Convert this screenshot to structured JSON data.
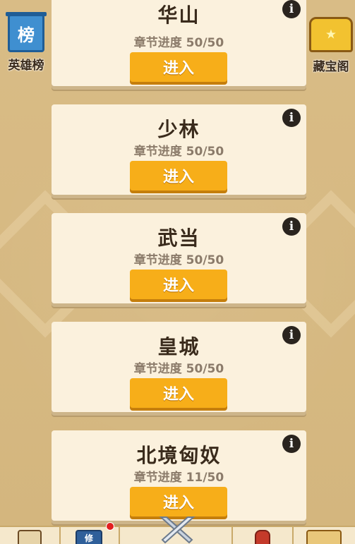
{
  "colors": {
    "background": "#d8bb84",
    "card": "#fbf1dd",
    "button": "#f7ae19",
    "title_text": "#3a2b1c",
    "progress_text": "#8b7b6a"
  },
  "side_left": {
    "icon_text": "榜",
    "label": "英雄榜"
  },
  "side_right": {
    "label": "藏宝阁"
  },
  "chapters": [
    {
      "title": "华山",
      "progress": "章节进度 50/50",
      "button": "进入",
      "info": "i"
    },
    {
      "title": "少林",
      "progress": "章节进度 50/50",
      "button": "进入",
      "info": "i"
    },
    {
      "title": "武当",
      "progress": "章节进度 50/50",
      "button": "进入",
      "info": "i"
    },
    {
      "title": "皇城",
      "progress": "章节进度 50/50",
      "button": "进入",
      "info": "i"
    },
    {
      "title": "北境匈奴",
      "progress": "章节进度 11/50",
      "button": "进入",
      "info": "i"
    }
  ],
  "bottom_tabs": [
    {
      "icon": "scroll-icon"
    },
    {
      "icon": "book-icon",
      "glyph": "修",
      "badge": true
    },
    {
      "icon": "crossed-swords-icon"
    },
    {
      "icon": "gourd-icon"
    },
    {
      "icon": "map-icon"
    }
  ]
}
